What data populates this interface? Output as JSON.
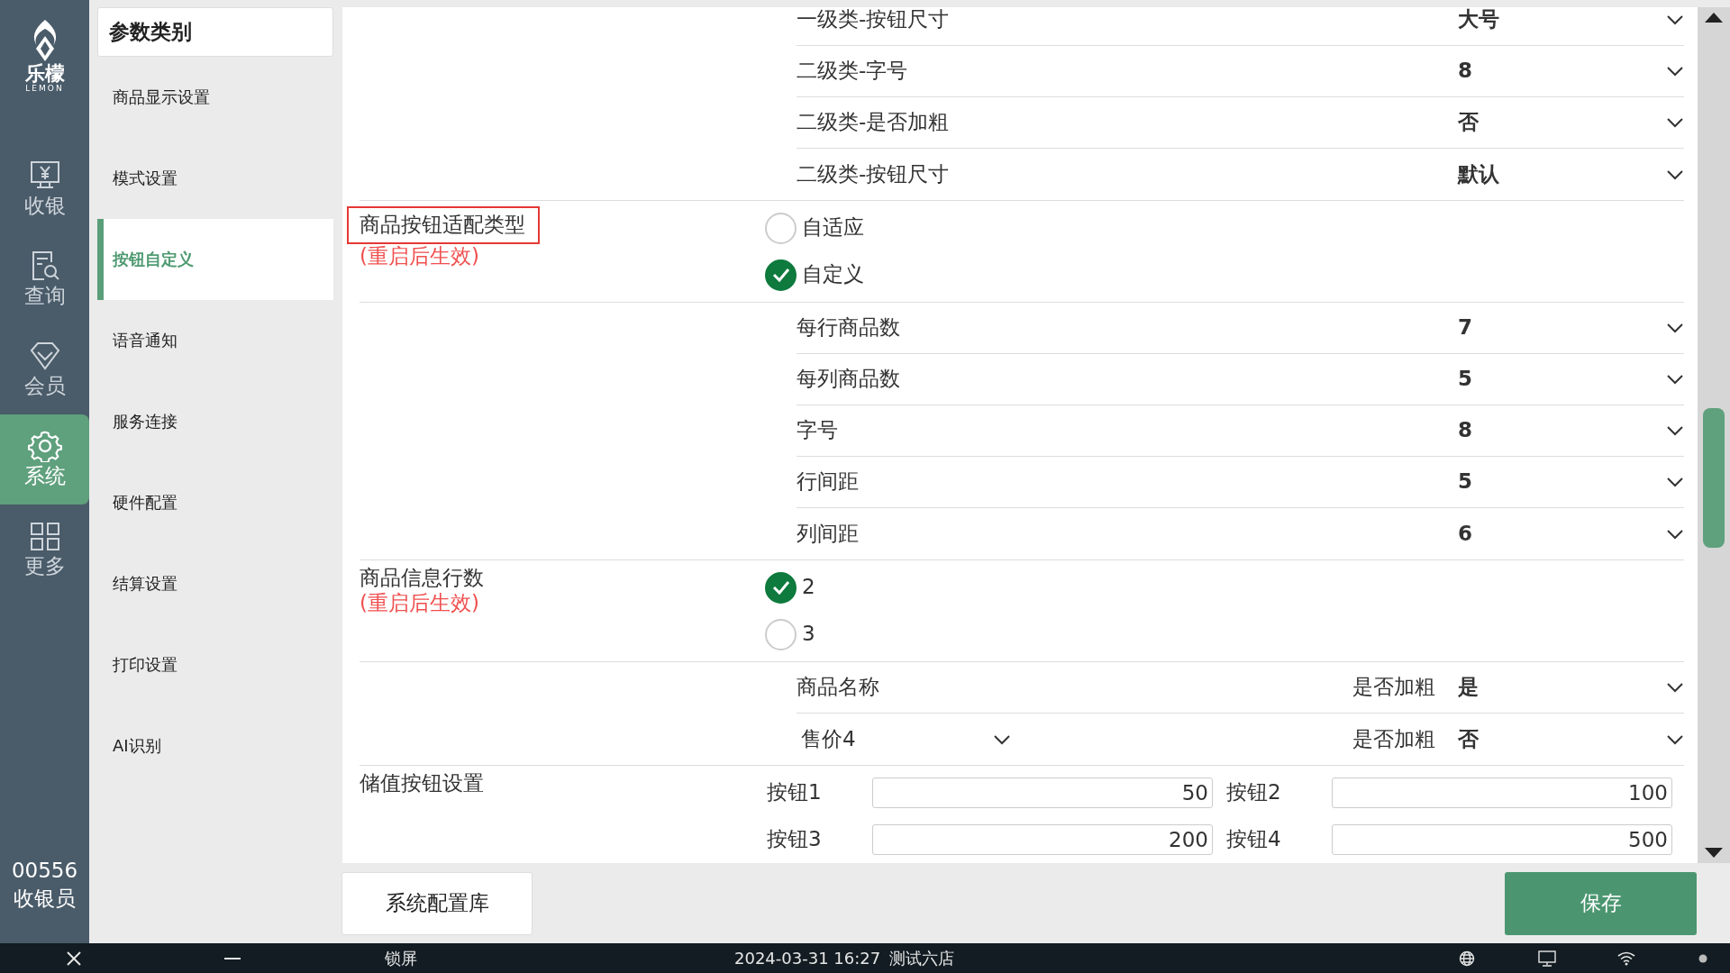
{
  "nav": {
    "logo_text": "乐檬",
    "logo_sub": "LEMON",
    "items": [
      {
        "label": "收银",
        "selected": false
      },
      {
        "label": "查询",
        "selected": false
      },
      {
        "label": "会员",
        "selected": false
      },
      {
        "label": "系统",
        "selected": true
      },
      {
        "label": "更多",
        "selected": false
      }
    ],
    "user_id": "00556",
    "user_role": "收银员"
  },
  "categories": {
    "title": "参数类别",
    "items": [
      {
        "label": "商品显示设置",
        "selected": false
      },
      {
        "label": "模式设置",
        "selected": false
      },
      {
        "label": "按钮自定义",
        "selected": true
      },
      {
        "label": "语音通知",
        "selected": false
      },
      {
        "label": "服务连接",
        "selected": false
      },
      {
        "label": "硬件配置",
        "selected": false
      },
      {
        "label": "结算设置",
        "selected": false
      },
      {
        "label": "打印设置",
        "selected": false
      },
      {
        "label": "AI识别",
        "selected": false
      }
    ]
  },
  "settings": [
    {
      "kind": "selects",
      "rows": [
        {
          "label": "一级类-按钮尺寸",
          "value": "大号"
        },
        {
          "label": "二级类-字号",
          "value": "8"
        },
        {
          "label": "二级类-是否加粗",
          "value": "否"
        },
        {
          "label": "二级类-按钮尺寸",
          "value": "默认"
        }
      ]
    },
    {
      "kind": "radio",
      "label": "商品按钮适配类型",
      "note": "(重启后生效)",
      "highlighted": true,
      "options": [
        {
          "label": "自适应",
          "selected": false
        },
        {
          "label": "自定义",
          "selected": true
        }
      ]
    },
    {
      "kind": "selects",
      "rows": [
        {
          "label": "每行商品数",
          "value": "7"
        },
        {
          "label": "每列商品数",
          "value": "5"
        },
        {
          "label": "字号",
          "value": "8"
        },
        {
          "label": "行间距",
          "value": "5"
        },
        {
          "label": "列间距",
          "value": "6"
        }
      ]
    },
    {
      "kind": "radio",
      "label": "商品信息行数",
      "note": "(重启后生效)",
      "highlighted": false,
      "options": [
        {
          "label": "2",
          "selected": true
        },
        {
          "label": "3",
          "selected": false
        }
      ]
    },
    {
      "kind": "bold_rows",
      "rows": [
        {
          "field": "商品名称",
          "dropdown": false,
          "label": "是否加粗",
          "value": "是"
        },
        {
          "field": "售价4",
          "dropdown": true,
          "label": "是否加粗",
          "value": "否"
        }
      ]
    },
    {
      "kind": "amounts",
      "label": "储值按钮设置",
      "buttons": [
        {
          "label": "按钮1",
          "value": "50"
        },
        {
          "label": "按钮2",
          "value": "100"
        },
        {
          "label": "按钮3",
          "value": "200"
        },
        {
          "label": "按钮4",
          "value": "500"
        }
      ]
    }
  ],
  "footer": {
    "library_button": "系统配置库",
    "save_button": "保存"
  },
  "taskbar": {
    "lock": "锁屏",
    "datetime": "2024-03-31 16:27",
    "store": "测试六店"
  }
}
